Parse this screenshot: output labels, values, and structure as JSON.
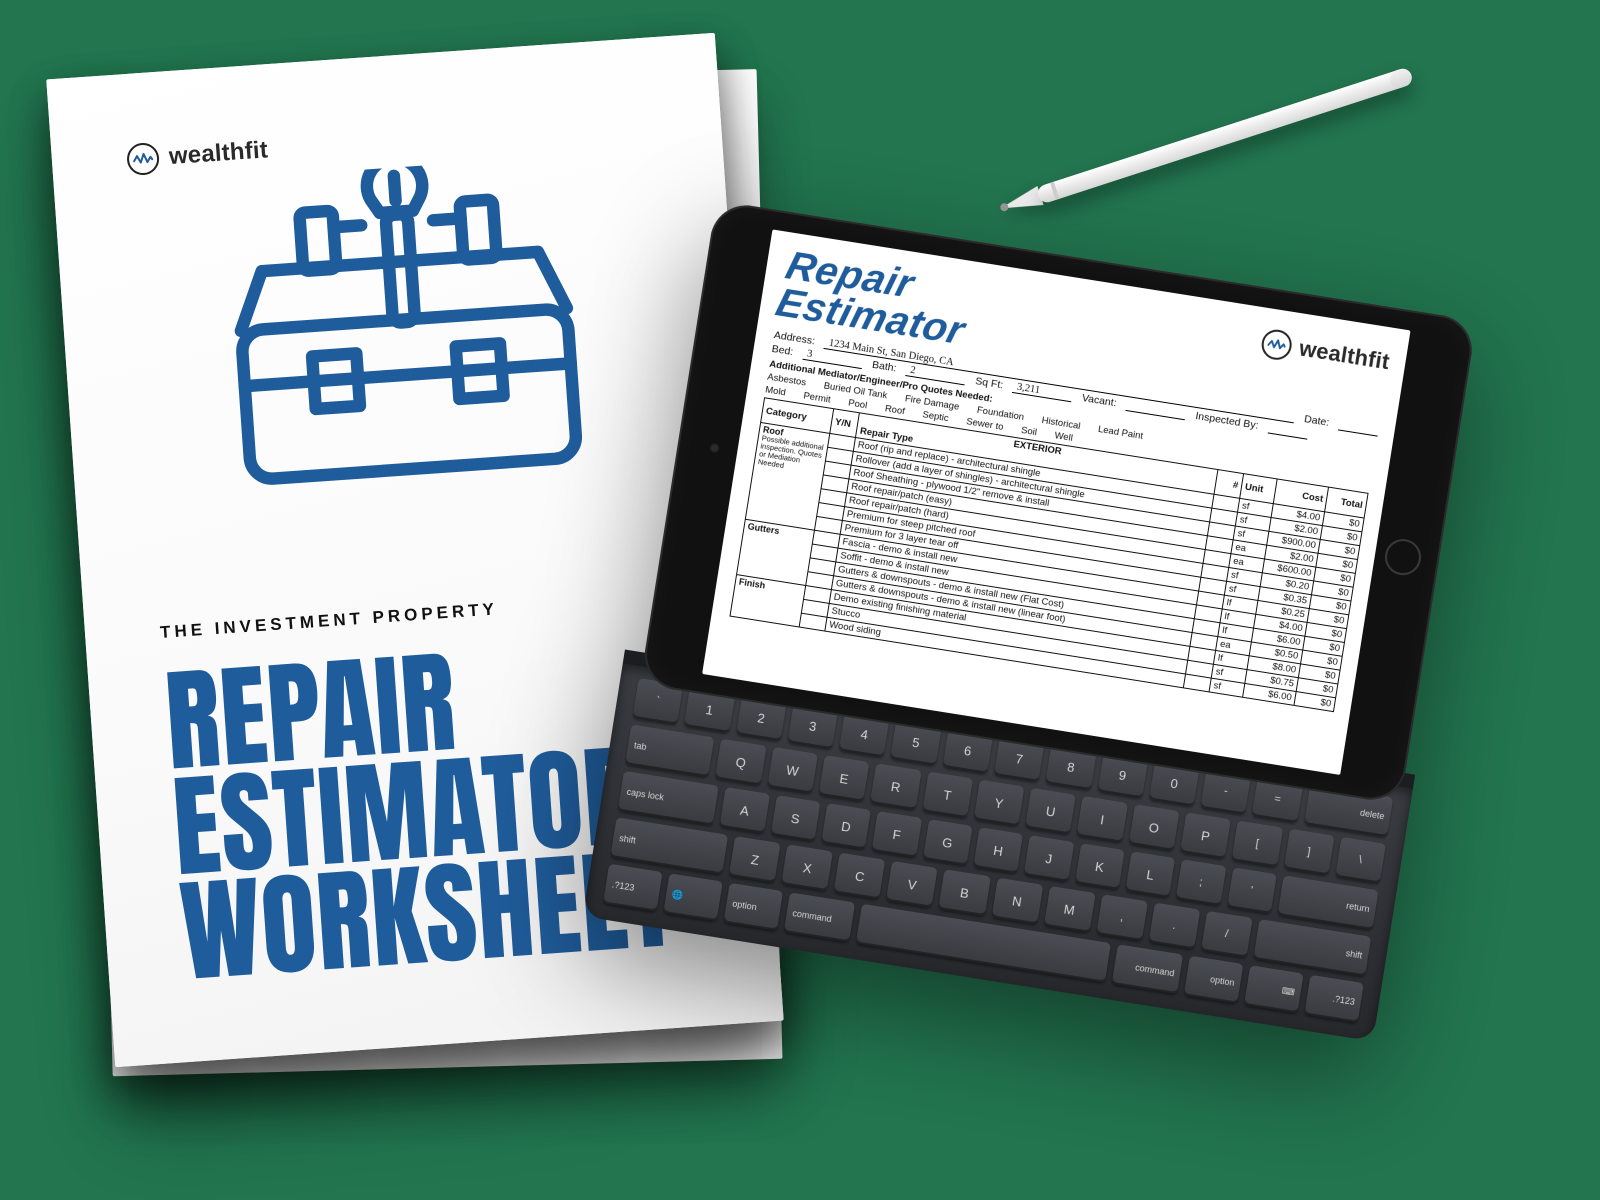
{
  "brand": {
    "name_bold": "wealth",
    "name_rest": "fit"
  },
  "paper": {
    "kicker": "THE INVESTMENT PROPERTY",
    "headline_l1": "REPAIR",
    "headline_l2": "ESTIMATOR",
    "headline_l3": "WORKSHEET"
  },
  "sheet": {
    "title_l1": "Repair",
    "title_l2": "Estimator",
    "labels": {
      "address": "Address:",
      "bed": "Bed:",
      "bath": "Bath:",
      "sqft": "Sq Ft:",
      "vacant": "Vacant:",
      "inspected": "Inspected By:",
      "date": "Date:",
      "additional": "Additional Mediator/Engineer/Pro Quotes Needed:"
    },
    "values": {
      "address": "1234 Main St, San Diego, CA",
      "bed": "3",
      "bath": "2",
      "sqft": "3,211",
      "vacant": "",
      "inspected": "",
      "date": ""
    },
    "tags_row1": [
      "Asbestos",
      "Buried Oil Tank",
      "Fire Damage",
      "Foundation",
      "Historical",
      "Lead Paint"
    ],
    "tags_row2": [
      "Mold",
      "Permit",
      "Pool",
      "Roof",
      "Septic",
      "Sewer to",
      "Soil",
      "Well"
    ],
    "table": {
      "section_title": "EXTERIOR",
      "cols": [
        "Category",
        "Y/N",
        "Repair Type",
        "#",
        "Unit",
        "Cost",
        "Total"
      ],
      "categories": {
        "roof": {
          "name": "Roof",
          "note": "Possible additional inspection. Quotes or Mediation Needed"
        },
        "gutters": {
          "name": "Gutters",
          "note": ""
        },
        "finish": {
          "name": "Finish",
          "note": ""
        }
      },
      "rows": [
        {
          "cat": "roof",
          "desc": "Roof (rip and replace) - architectural shingle",
          "unit": "sf",
          "cost": "$4.00",
          "total": "$0"
        },
        {
          "cat": "roof",
          "desc": "Rollover (add a layer of shingles) - architectural shingle",
          "unit": "sf",
          "cost": "$2.00",
          "total": "$0"
        },
        {
          "cat": "roof",
          "desc": "Roof Sheathing - plywood 1/2\" remove & install",
          "unit": "sf",
          "cost": "$900.00",
          "total": "$0"
        },
        {
          "cat": "roof",
          "desc": "Roof repair/patch (easy)",
          "unit": "ea",
          "cost": "$2.00",
          "total": "$0"
        },
        {
          "cat": "roof",
          "desc": "Roof repair/patch (hard)",
          "unit": "ea",
          "cost": "$600.00",
          "total": "$0"
        },
        {
          "cat": "roof",
          "desc": "Premium for steep pitched roof",
          "unit": "sf",
          "cost": "$0.20",
          "total": "$0"
        },
        {
          "cat": "roof",
          "desc": "Premium for 3 layer tear off",
          "unit": "sf",
          "cost": "$0.35",
          "total": "$0"
        },
        {
          "cat": "gutters",
          "desc": "Fascia - demo & install new",
          "unit": "lf",
          "cost": "$0.25",
          "total": "$0"
        },
        {
          "cat": "gutters",
          "desc": "Soffit - demo & install new",
          "unit": "lf",
          "cost": "$4.00",
          "total": "$0"
        },
        {
          "cat": "gutters",
          "desc": "Gutters & downspouts - demo & install new (Flat Cost)",
          "unit": "lf",
          "cost": "$6.00",
          "total": "$0"
        },
        {
          "cat": "gutters",
          "desc": "Gutters & downspouts - demo & install new (linear foot)",
          "unit": "ea",
          "cost": "$0.50",
          "total": "$0"
        },
        {
          "cat": "finish",
          "desc": "Demo existing finishing material",
          "unit": "lf",
          "cost": "$8.00",
          "total": "$0"
        },
        {
          "cat": "finish",
          "desc": "Stucco",
          "unit": "sf",
          "cost": "$0.75",
          "total": "$0"
        },
        {
          "cat": "finish",
          "desc": "Wood siding",
          "unit": "sf",
          "cost": "$6.00",
          "total": "$0"
        }
      ]
    }
  },
  "keyboard": {
    "row0": [
      "`",
      "1",
      "2",
      "3",
      "4",
      "5",
      "6",
      "7",
      "8",
      "9",
      "0",
      "-",
      "=",
      "delete"
    ],
    "row1": [
      "tab",
      "Q",
      "W",
      "E",
      "R",
      "T",
      "Y",
      "U",
      "I",
      "O",
      "P",
      "[",
      "]",
      "\\"
    ],
    "row2": [
      "caps lock",
      "A",
      "S",
      "D",
      "F",
      "G",
      "H",
      "J",
      "K",
      "L",
      ";",
      "'",
      "return"
    ],
    "row3": [
      "shift",
      "Z",
      "X",
      "C",
      "V",
      "B",
      "N",
      "M",
      ",",
      ".",
      "/",
      "shift"
    ],
    "row4": [
      ".?123",
      "",
      "option",
      "command",
      "",
      "command",
      "option",
      "",
      ".?123"
    ]
  }
}
